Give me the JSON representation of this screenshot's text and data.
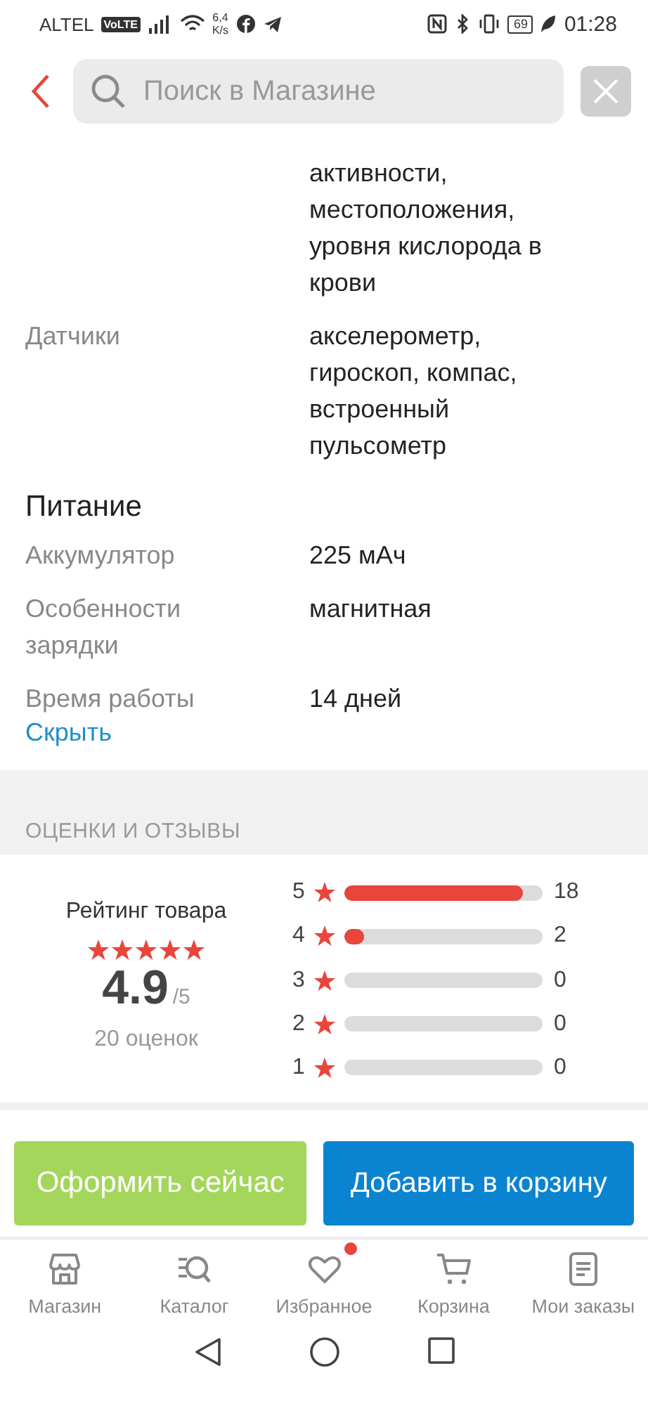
{
  "status_bar": {
    "carrier": "ALTEL",
    "volte": "VoLTE",
    "speed_value": "6,4",
    "speed_unit": "K/s",
    "battery": "69",
    "time": "01:28"
  },
  "header": {
    "search": {
      "placeholder": "Поиск в Магазине"
    }
  },
  "specs": [
    {
      "value": "активности, местоположения, уровня кислорода в крови"
    },
    {
      "label": "Датчики",
      "value": "акселерометр, гироскоп, компас, встроенный пульсометр"
    },
    {
      "heading": "Питание"
    },
    {
      "label": "Аккумулятор",
      "value": "225 мАч"
    },
    {
      "label": "Особенности зарядки",
      "value": "магнитная"
    },
    {
      "label": "Время работы",
      "value": "14 дней"
    }
  ],
  "hide_link": "Скрыть",
  "reviews": {
    "section_title": "ОЦЕНКИ И ОТЗЫВЫ",
    "rating_label": "Рейтинг товара",
    "stars": 5,
    "score": "4.9",
    "score_max": "/5",
    "count": "20 оценок",
    "bars": [
      {
        "grade": "5",
        "level": 0.9,
        "count": "18"
      },
      {
        "grade": "4",
        "level": 0.1,
        "count": "2"
      },
      {
        "grade": "3",
        "level": 0,
        "count": "0"
      },
      {
        "grade": "2",
        "level": 0,
        "count": "0"
      },
      {
        "grade": "1",
        "level": 0,
        "count": "0"
      }
    ]
  },
  "actions": [
    {
      "kind": "buy",
      "label": "Оформить сейчас"
    },
    {
      "kind": "cart",
      "label": "Добавить в корзину"
    }
  ],
  "tab_bar": [
    {
      "label": "Магазин",
      "badge": false
    },
    {
      "label": "Каталог",
      "badge": false
    },
    {
      "label": "Избранное",
      "badge": true
    },
    {
      "label": "Корзина",
      "badge": false
    },
    {
      "label": "Мои заказы",
      "badge": false
    }
  ]
}
